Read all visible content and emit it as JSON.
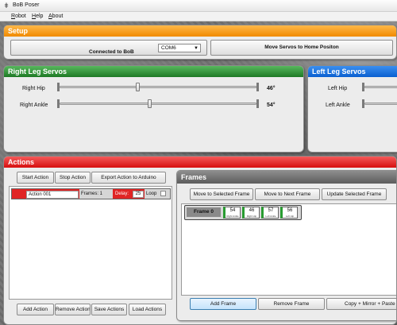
{
  "window": {
    "title": "BoB Poser",
    "icon": "robot-legs-icon"
  },
  "menu": [
    {
      "underline": "R",
      "rest": "obot"
    },
    {
      "underline": "H",
      "rest": "elp"
    },
    {
      "underline": "A",
      "rest": "bout"
    }
  ],
  "setup": {
    "title": "Setup",
    "connection_label": "Connected to BoB",
    "port_value": "COM6",
    "home_button": "Move Servos to Home Positon"
  },
  "right_leg": {
    "title": "Right Leg Servos",
    "servos": [
      {
        "label": "Right Hip",
        "value": "46°",
        "level": 46
      },
      {
        "label": "Right Ankle",
        "value": "54°",
        "level": 54
      }
    ]
  },
  "left_leg": {
    "title": "Left Leg Servos",
    "servos": [
      {
        "label": "Left Hip"
      },
      {
        "label": "Left Ankle"
      }
    ]
  },
  "actions": {
    "title": "Actions",
    "buttons": {
      "start": "Start Action",
      "stop": "Stop Action",
      "export": "Export Action to Arduino"
    },
    "list": [
      {
        "name": "Action 001",
        "frames_label": "Frames: 1",
        "delay_label": "Delay:",
        "delay_value": "25",
        "loop_label": "Loop"
      }
    ],
    "bottom_buttons": {
      "add": "Add Action",
      "remove": "Remove Action",
      "save": "Save Actions",
      "load": "Load Actions"
    }
  },
  "frames": {
    "title": "Frames",
    "buttons": {
      "move_selected": "Move to Selected Frame",
      "move_next": "Move to Next Frame",
      "update": "Update Selected Frame"
    },
    "list": [
      {
        "label": "Frame 0",
        "servos": [
          {
            "value": "54",
            "name": "Right Ankle"
          },
          {
            "value": "46",
            "name": "Right Hip"
          },
          {
            "value": "57",
            "name": "Left Ankle"
          },
          {
            "value": "56",
            "name": "Left Hip"
          }
        ]
      }
    ],
    "bottom_buttons": {
      "add": "Add Frame",
      "remove": "Remove Frame",
      "copy": "Copy + Mirror + Paste"
    }
  },
  "colors": {
    "setup": "#f08a00",
    "right_leg": "#1e7a25",
    "left_leg": "#0a5fd0",
    "actions": "#d70f0f",
    "frames": "#5c5c5c",
    "servo_chip_accent": "#2a9d32"
  }
}
